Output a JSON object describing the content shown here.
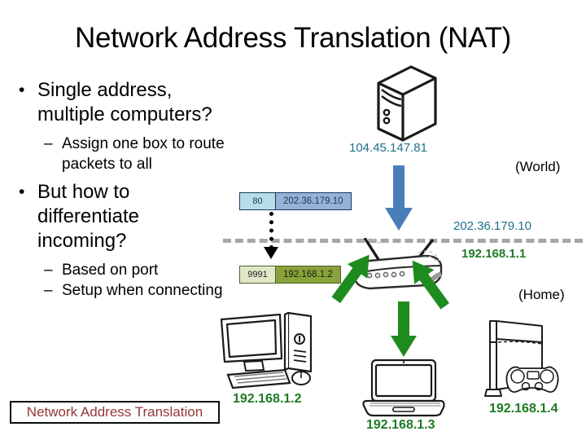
{
  "slide": {
    "title": "Network Address Translation (NAT)"
  },
  "bullets": [
    {
      "level": 1,
      "marker": "•",
      "text": "Single address, multiple computers?"
    },
    {
      "level": 2,
      "marker": "–",
      "text": "Assign one box to route packets to all"
    },
    {
      "level": 1,
      "marker": "•",
      "text": "But how to differentiate incoming?"
    },
    {
      "level": 2,
      "marker": "–",
      "text": "Based on port"
    },
    {
      "level": 2,
      "marker": "–",
      "text": "Setup when connecting"
    }
  ],
  "footer_label": {
    "text": "Network Address Translation",
    "color": "#943634",
    "border_color": "#0d0d0d"
  },
  "diagram": {
    "packets": {
      "outgoing": {
        "port": "80",
        "address": "202.36.179.10",
        "port_bg": "#b7dee8",
        "address_bg": "#95b3d7"
      },
      "incoming": {
        "port": "9991",
        "address": "192.168.1.2",
        "port_bg": "#e0e8c8",
        "address_bg": "#89a23b"
      }
    },
    "captions": {
      "server_ip": "104.45.147.81",
      "world_label": "(World)",
      "router_wan_ip": "202.36.179.10",
      "router_lan_ip": "192.168.1.1",
      "home_label": "(Home)",
      "desktop_ip": "192.168.1.2",
      "laptop_ip": "192.168.1.3",
      "console_ip": "192.168.1.4"
    },
    "colors": {
      "blue_arrow": "#4a7ebb",
      "green_arrow": "#1e8b1e",
      "boundary_dash": "#a6a6a6",
      "blue_text": "#1f6f8b",
      "green_text": "#1e7a24"
    },
    "devices": [
      "server-tower",
      "wireless-router",
      "desktop-computer",
      "laptop-computer",
      "game-console"
    ]
  }
}
